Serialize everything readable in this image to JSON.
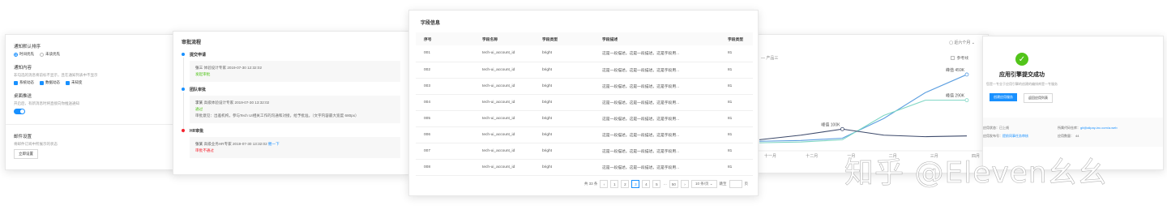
{
  "settings": {
    "notify_label": "通知默认排序",
    "opt_time": "时间优先",
    "opt_unread": "未读优先",
    "content_label": "通知内容",
    "content_desc": "非勾选的消息将前标不显示，且在通知列表中不显示",
    "cb1": "系统动态",
    "cb2": "数据动态",
    "cb3": "未知变",
    "desktop_label": "桌面推送",
    "desktop_desc": "开启后，有新消息时将直接向你推送通知",
    "email_label": "邮件设置",
    "email_desc": "将邮件订阅中所展示的状态",
    "email_btn": "立即设置"
  },
  "approval": {
    "title": "审批流程",
    "steps": [
      {
        "name": "提交申请",
        "who": "张三",
        "role": "体验设计专家",
        "time": "2019-07-30 12:32:02",
        "status": "发起审批"
      },
      {
        "name": "团队审批",
        "who": "李某",
        "role": "高级体验设计专家",
        "time": "2019-07-30 13:32:02",
        "status": "通过",
        "comment": "审批意见：出差机构，参与Tech UI相关工作的沟通和对接，给予批准。（文字内容最大宽度 680px）"
      },
      {
        "name": "HR审批",
        "who": "张某",
        "role": "高级业务HR专家",
        "time": "2019-07-30 13:32:02",
        "extra": "催一下",
        "status": "审批不通过"
      }
    ]
  },
  "fields": {
    "title": "字段信息",
    "columns": [
      "序号",
      "字段名称",
      "字段类型",
      "字段描述",
      "字段类型"
    ],
    "rows": [
      [
        "001",
        "tech-ui_account_id",
        "bright",
        "这是一段描述。这是一段描述。这是字段用...",
        "81"
      ],
      [
        "002",
        "tech-ui_account_id",
        "bright",
        "这是一段描述。这是一段描述。这是字段用...",
        "81"
      ],
      [
        "003",
        "tech-ui_account_id",
        "bright",
        "这是一段描述。这是一段描述。这是字段用...",
        "81"
      ],
      [
        "004",
        "tech-ui_account_id",
        "bright",
        "这是一段描述。这是一段描述。这是字段用...",
        "81"
      ],
      [
        "005",
        "tech-ui_account_id",
        "bright",
        "这是一段描述。这是一段描述。这是字段用...",
        "81"
      ],
      [
        "006",
        "tech-ui_account_id",
        "bright",
        "这是一段描述。这是一段描述。这是字段用...",
        "81"
      ],
      [
        "007",
        "tech-ui_account_id",
        "bright",
        "这是一段描述。这是一段描述。这是字段用...",
        "81"
      ],
      [
        "008",
        "tech-ui_account_id",
        "bright",
        "这是一段描述。这是一段描述。这是字段用...",
        "81"
      ]
    ],
    "pager": {
      "total": "共 33 条",
      "pages": [
        "1",
        "2",
        "3",
        "4",
        "5",
        "···",
        "50"
      ],
      "active": "3",
      "size": "10 条/页",
      "jump": "跳至",
      "page_unit": "页"
    }
  },
  "chart": {
    "range": "近六个月",
    "legend3": "产品三",
    "reference": "参考线",
    "peak1": "峰值 459K",
    "peak2": "峰值 290K",
    "peak3": "峰值 100K",
    "colors": {
      "blue": "#5b9ee0",
      "teal": "#7fd6c4",
      "navy": "#3d4a6b"
    }
  },
  "chart_data": {
    "type": "line",
    "categories": [
      "十一月",
      "十二月",
      "一月",
      "二月",
      "三月",
      "四月"
    ],
    "series": [
      {
        "values": [
          20,
          25,
          40,
          170,
          340,
          459
        ]
      },
      {
        "values": [
          10,
          15,
          30,
          190,
          290,
          290
        ]
      },
      {
        "values": [
          30,
          60,
          100,
          60,
          50,
          55
        ]
      }
    ],
    "ylim": [
      0,
      480
    ]
  },
  "success": {
    "title": "应用引擎提交成功",
    "sub": "您是一专业于应用引擎的创建的编排库是一专服务",
    "btn_primary": "创建应用服务",
    "btn_secondary": "返回应用列表",
    "info": {
      "status_label": "应用状态：",
      "status_value": "已上线",
      "repo_label": "所属代码仓库：",
      "repo_value": "git@alipay-inc.com/a.web",
      "deploy_label": "应用发布号：",
      "deploy_value": "提前同事任务审核",
      "count_label": "应用数量：",
      "count_value": "44"
    }
  },
  "watermark": "知乎 @Eleven幺幺"
}
